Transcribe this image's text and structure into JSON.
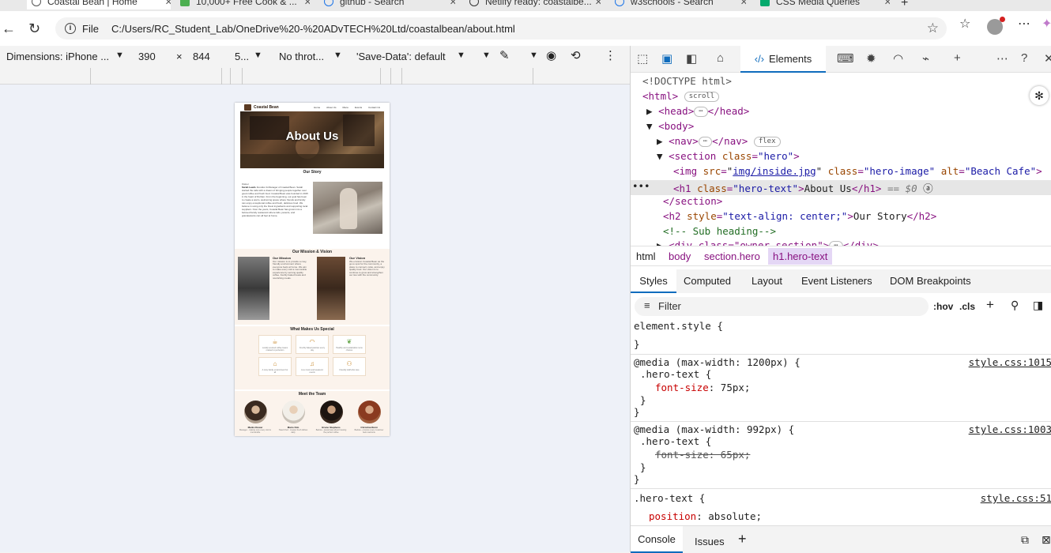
{
  "browser": {
    "tabs": [
      {
        "label": "Coastal Bean | Home",
        "active": true,
        "icon_color": "#555555"
      },
      {
        "label": "10,000+ Free Cook & ...",
        "icon_color": "#4caf50"
      },
      {
        "label": "github - Search",
        "icon_color": "#1a73e8"
      },
      {
        "label": "Netlify ready: coastalbe...",
        "icon_color": "#333333"
      },
      {
        "label": "w3schools - Search",
        "icon_color": "#1a73e8"
      },
      {
        "label": "CSS Media Queries",
        "icon_color": "#04aa6d"
      }
    ],
    "address": {
      "scheme_label": "File",
      "url": "C:/Users/RC_Student_Lab/OneDrive%20-%20ADvTECH%20Ltd/coastalbean/about.html"
    }
  },
  "device_toolbar": {
    "dimensions_label": "Dimensions: iPhone ...",
    "width": "390",
    "times": "×",
    "height": "844",
    "zoom": "5...",
    "throttle": "No throt...",
    "save_data": "'Save-Data': default"
  },
  "device_page": {
    "brand": "Coastal Bean",
    "nav_links": [
      "Home",
      "About Us",
      "Menu",
      "Events",
      "Contact Us"
    ],
    "hero_title": "About Us",
    "our_story_heading": "Our Story",
    "story_owner_label": "Owner",
    "story_owner_name": "Sarah Leeds",
    "story_text": "Founder & Manager of Coastal Bean. Sarah started the café with a dream of bringing people together over good coffee and fresh food. Coastal Bean was founded in 2015 in the heart of Durban. From the beginning, our goal has been to create a warm, welcoming space where friends and family can enjoy exceptional coffee and fresh, delicious food. We believe in using only the finest ingredients and supporting local suppliers. Over the years, Coastal Bean has grown into a beloved family restaurant where kids, parents, and grandparents can all feel at home.",
    "mission_vision_heading": "Our Mission & Vision",
    "mission_title": "Our Mission",
    "mission_text": "Our mission is to provide a cosy, friendly environment where everyone feels at home. We aim to make every visit a memorable experience by serving quality coffee, freshly baked treats and nourishing meals.",
    "vision_title": "Our Vision",
    "vision_text": "We envision Coastal Bean as the go-to spot for the community, a place to connect, relax, and enjoy quality food. Our vision is to continue to grow and strengthen our ties with the community.",
    "special_heading": "What Makes Us Special",
    "special_cards": [
      {
        "icon": "coffee-cup-icon",
        "glyph": "☕",
        "text": "Locally sourced coffee beans roasted to perfection"
      },
      {
        "icon": "bread-icon",
        "glyph": "🍞",
        "text": "Freshly baked pastries every day"
      },
      {
        "icon": "leaf-icon",
        "glyph": "🍃",
        "text": "Healthy and sustainable menu choices"
      },
      {
        "icon": "home-icon",
        "glyph": "⌂",
        "text": "A cosy family environment for all"
      },
      {
        "icon": "music-icon",
        "glyph": "♫",
        "text": "Live music and weekend events"
      },
      {
        "icon": "people-icon",
        "glyph": "⚇",
        "text": "Friendly staff who care"
      }
    ],
    "team_heading": "Meet the Team",
    "team": [
      {
        "name": "Marko Dower",
        "role": "Manager - making sure every visit is memorable"
      },
      {
        "name": "Mario Kim",
        "role": "Head Chef - creates fresh dishes daily"
      },
      {
        "name": "Bruno Stephens",
        "role": "Barista - passionate about brewing the perfect coffee"
      },
      {
        "name": "Christina Remi",
        "role": "Barista - ensures every customer feels welcome"
      }
    ]
  },
  "devtools": {
    "panel_tab": "Elements",
    "dom": {
      "doctype": "<!DOCTYPE html>",
      "html_open": "<html>",
      "scroll_badge": "scroll",
      "head_open": "<head>",
      "head_close": "</head>",
      "ellipsis": "⋯",
      "body_open": "<body>",
      "nav_open": "<nav>",
      "nav_close": "</nav>",
      "flex_badge": "flex",
      "section_open": "<section",
      "section_attr_name": "class",
      "section_attr_value": "\"hero\"",
      "gt": ">",
      "img_open": "<img",
      "img_src_name": "src",
      "img_src_value": "img/inside.jpg",
      "img_class_name": "class",
      "img_class_value": "\"hero-image\"",
      "img_alt_name": "alt",
      "img_alt_value": "\"Beach Cafe\"",
      "h1_open": "<h1",
      "h1_class_name": "class",
      "h1_class_value": "\"hero-text\"",
      "h1_text": "About Us",
      "h1_close": "</h1>",
      "h1_ref": "== $0",
      "section_close": "</section>",
      "h2_open": "<h2",
      "h2_style_name": "style",
      "h2_style_value": "\"text-align: center;\"",
      "h2_text": "Our Story",
      "h2_close": "</h2>",
      "comment": "<!-- Sub heading-->",
      "div_partial": "<div class=\"owner-section\">",
      "div_close": "</div>",
      "eq": "="
    },
    "breadcrumbs": [
      "html",
      "body",
      "section.hero",
      "h1.hero-text"
    ],
    "side_tabs": [
      "Styles",
      "Computed",
      "Layout",
      "Event Listeners",
      "DOM Breakpoints"
    ],
    "filter_placeholder": "Filter",
    "hov": ":hov",
    "cls": ".cls",
    "styles": {
      "element_style": "element.style {",
      "close_brace": "}",
      "media1": "@media",
      "media1_cond": "(max-width: 1200px) {",
      "media1_selector": ".hero-text {",
      "media1_prop": "font-size",
      "media1_val": "75px;",
      "media1_src": "style.css:1015",
      "media2": "@media",
      "media2_cond": "(max-width: 992px) {",
      "media2_selector": ".hero-text {",
      "media2_prop": "font-size: 65px;",
      "media2_src": "style.css:1003",
      "rule3_selector": ".hero-text {",
      "rule3_prop": "position",
      "rule3_val": "absolute;",
      "rule3_src": "style.css:51"
    },
    "drawer_tabs": [
      "Console",
      "Issues"
    ]
  }
}
